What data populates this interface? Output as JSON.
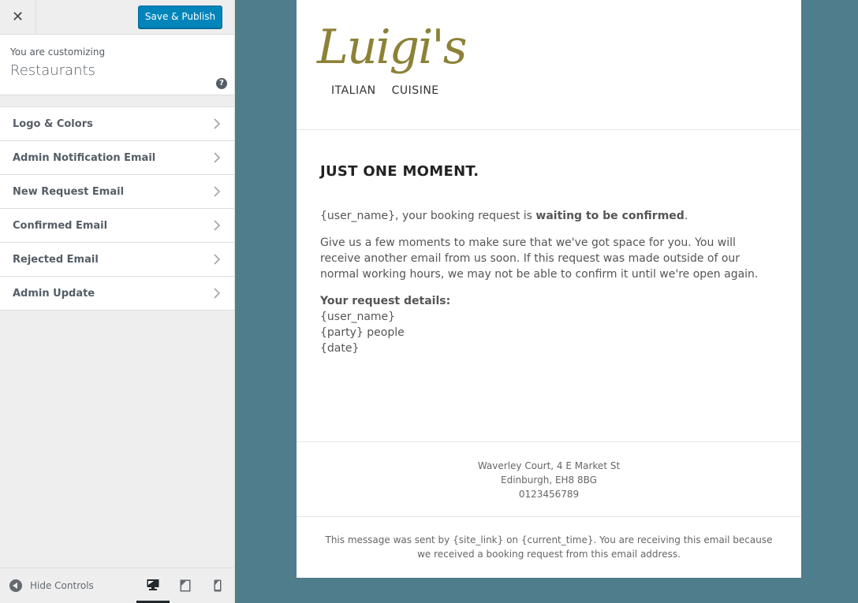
{
  "sidebar": {
    "close_icon": "close-icon",
    "save_publish_label": "Save & Publish",
    "customizing_label": "You are customizing",
    "site_title": "Restaurants",
    "help_icon": "help-icon",
    "sections": [
      {
        "label": "Logo & Colors"
      },
      {
        "label": "Admin Notification Email"
      },
      {
        "label": "New Request Email"
      },
      {
        "label": "Confirmed Email"
      },
      {
        "label": "Rejected Email"
      },
      {
        "label": "Admin Update"
      }
    ],
    "hide_controls_label": "Hide Controls",
    "devices": [
      {
        "name": "desktop",
        "active": true
      },
      {
        "name": "tablet",
        "active": false
      },
      {
        "name": "mobile",
        "active": false
      }
    ]
  },
  "colors": {
    "accent": "#0085ba",
    "preview_background": "#4f7d8c",
    "logo_gold": "#8c8137"
  },
  "email": {
    "logo": {
      "script": "Luigi's",
      "sub_left": "ITALIAN",
      "sub_right": "CUISINE"
    },
    "heading": "JUST ONE MOMENT.",
    "intro_prefix": "{user_name}, your booking request is ",
    "intro_bold": "waiting to be confirmed",
    "intro_suffix": ".",
    "paragraph": "Give us a few moments to make sure that we've got space for you. You will receive another email from us soon. If this request was made outside of our normal working hours, we may not be able to confirm it until we're open again.",
    "details_title": "Your request details:",
    "details": [
      "{user_name}",
      "{party} people",
      "{date}"
    ],
    "address_lines": [
      "Waverley Court, 4 E Market St",
      "Edinburgh, EH8 8BG",
      "0123456789"
    ],
    "footer": "This message was sent by {site_link} on {current_time}. You are receiving this email because we received a booking request from this email address."
  }
}
